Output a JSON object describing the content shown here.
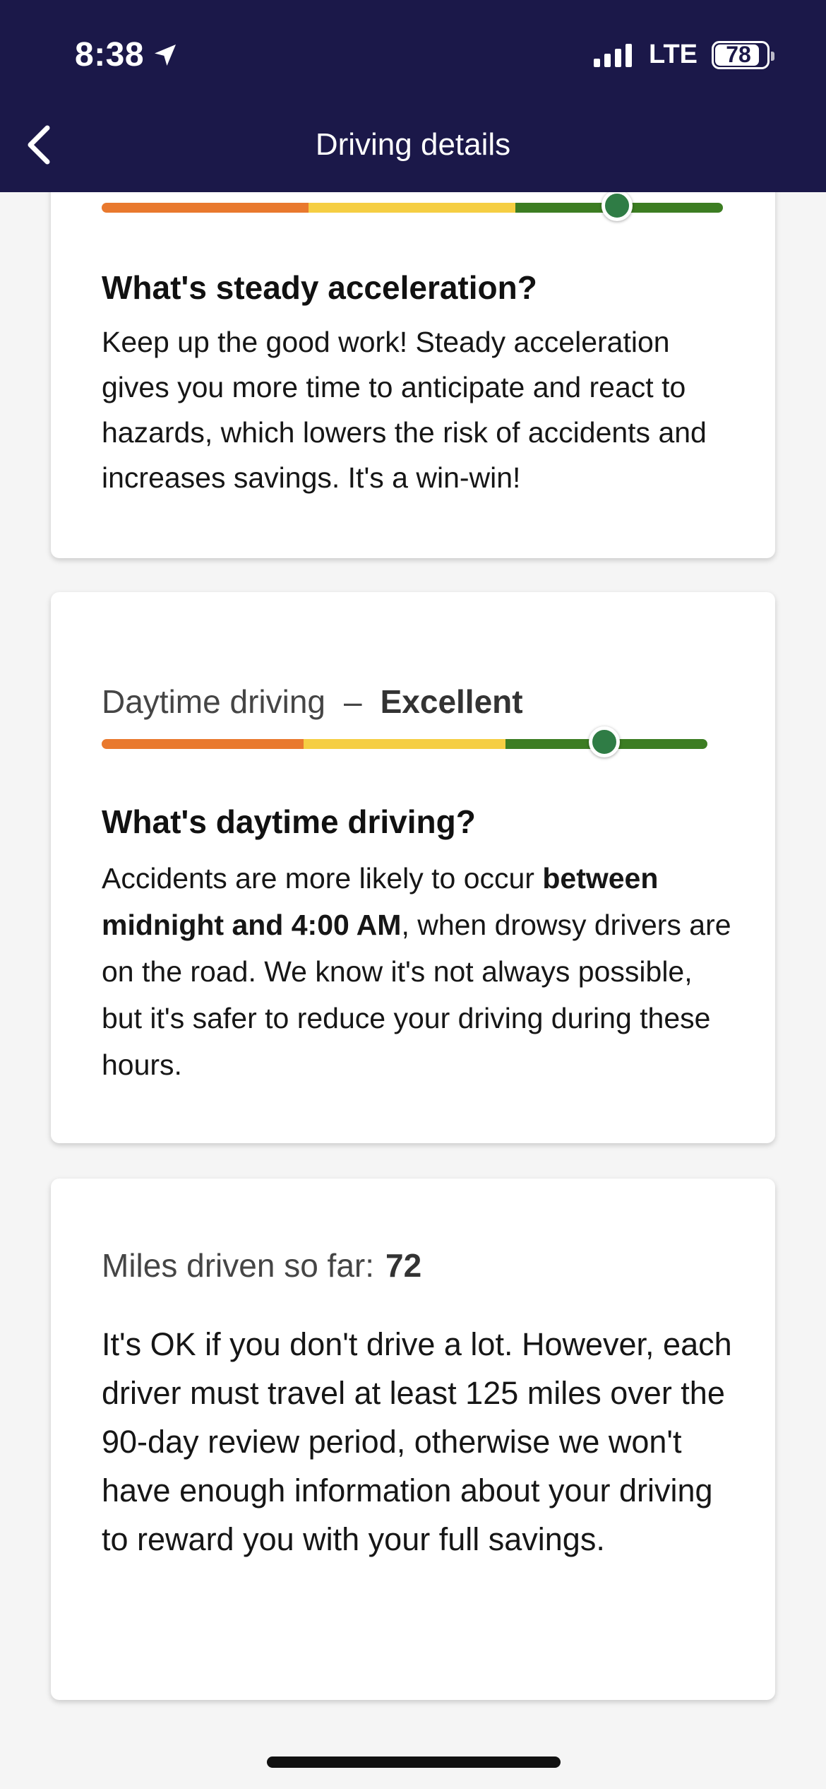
{
  "status_bar": {
    "time": "8:38",
    "network": "LTE",
    "battery": "78"
  },
  "nav": {
    "title": "Driving details",
    "back_icon": "chevron-left-icon"
  },
  "colors": {
    "header_bg": "#1b1849",
    "slider_low": "#e9792e",
    "slider_mid": "#f5ce43",
    "slider_high": "#3c7d22",
    "knob": "#2f7c45"
  },
  "cards": [
    {
      "slider_level": 0.83,
      "question": "What's steady acceleration?",
      "body": "Keep up the good work! Steady acceleration gives you more time to anticipate and react to hazards, which lowers the risk of accidents and increases savings. It's a win-win!"
    },
    {
      "metric_label": "Daytime driving",
      "separator": "–",
      "metric_value": "Excellent",
      "slider_level": 0.83,
      "question": "What's daytime driving?",
      "body_pre": "Accidents are more likely to occur ",
      "body_bold": "between midnight and 4:00 AM",
      "body_post": ", when drowsy drivers are on the road. We know it's not always possible, but it's safer to reduce your driving during these hours."
    },
    {
      "metric_label": "Miles driven so far:",
      "metric_value": "72",
      "body": "It's OK if you don't drive a lot. However, each driver must travel at least 125 miles over the 90-day review period, otherwise we won't have enough information about your driving to reward you with your full savings."
    }
  ]
}
